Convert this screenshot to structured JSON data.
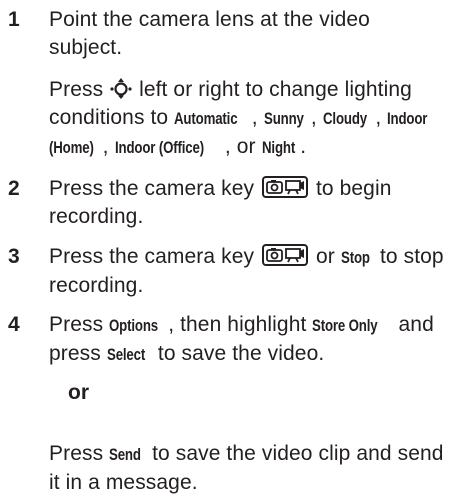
{
  "steps": [
    {
      "number": "1",
      "line1": "Point the camera lens at the video",
      "line2": "subject.",
      "sub": {
        "press": "Press",
        "after_icon": "left or right to change lighting",
        "line2_prefix": "conditions to",
        "options": [
          "Automatic",
          "Sunny",
          "Cloudy",
          "Indoor",
          "(Home)",
          "Indoor (Office)",
          "Night"
        ],
        "sep": ",",
        "or": "or",
        "end": "."
      }
    },
    {
      "number": "2",
      "before": "Press the camera key",
      "after": "to begin",
      "line2": "recording."
    },
    {
      "number": "3",
      "before": "Press the camera key",
      "or": "or",
      "stop": "Stop",
      "after": "to stop",
      "line2": "recording."
    },
    {
      "number": "4",
      "press": "Press",
      "options": "Options",
      "then": ", then highlight",
      "store": "Store Only",
      "and": "and",
      "press2": "press",
      "select": "Select",
      "rest": "to save the video."
    }
  ],
  "or_label": "or",
  "final": {
    "press": "Press",
    "send": "Send",
    "rest": "to save the video clip and send",
    "line2": "it in a message."
  },
  "icons": {
    "nav": "nav-key-icon",
    "camera": "camera-key-icon"
  }
}
